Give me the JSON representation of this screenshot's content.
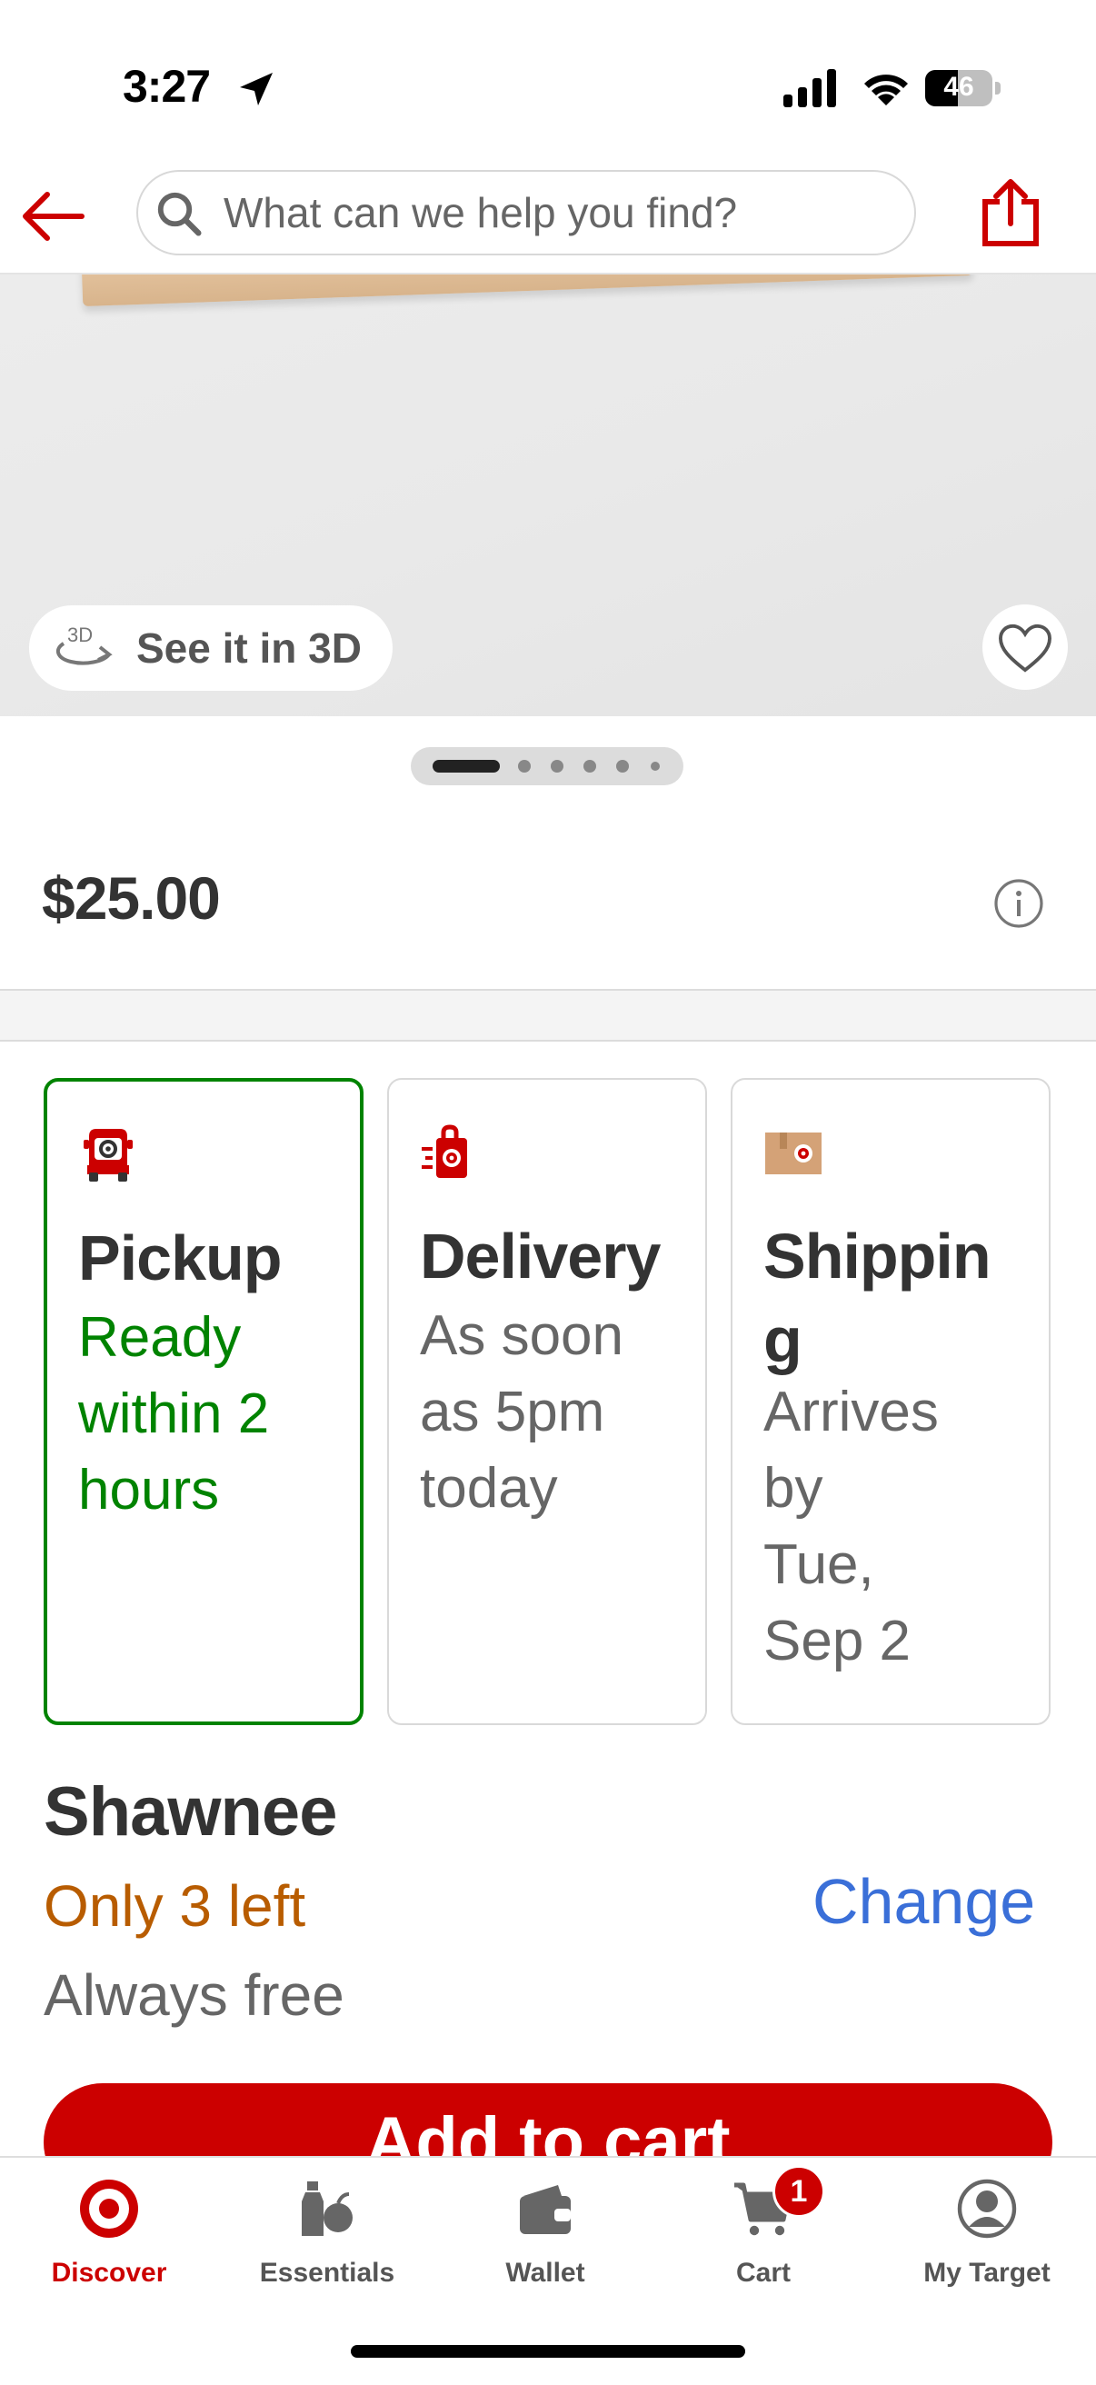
{
  "status_bar": {
    "time": "3:27",
    "battery": "46"
  },
  "header": {
    "search_placeholder": "What can we help you find?"
  },
  "hero": {
    "see_3d_label": "See it in 3D",
    "image_count": 6,
    "active_index": 0
  },
  "product": {
    "price": "$25.00"
  },
  "fulfillment": [
    {
      "title": "Pickup",
      "title_lines": [
        "Pickup"
      ],
      "subtitle_lines": [
        "Ready",
        "within 2",
        "hours"
      ],
      "selected": true,
      "icon": "pickup-car-icon"
    },
    {
      "title": "Delivery",
      "title_lines": [
        "Delivery"
      ],
      "subtitle_lines": [
        "As soon",
        "as 5pm",
        "today"
      ],
      "selected": false,
      "icon": "delivery-bag-icon"
    },
    {
      "title": "Shipping",
      "title_lines": [
        "Shippin",
        "g"
      ],
      "subtitle_lines": [
        "Arrives",
        "by",
        "Tue,",
        "Sep 2"
      ],
      "selected": false,
      "icon": "shipping-box-icon"
    }
  ],
  "store": {
    "name": "Shawnee",
    "stock": "Only 3 left",
    "price_note": "Always free",
    "change_label": "Change"
  },
  "add_to_cart": {
    "label": "Add to cart"
  },
  "tabbar": {
    "tabs": [
      {
        "label": "Discover",
        "icon": "target-bullseye-icon",
        "active": true
      },
      {
        "label": "Essentials",
        "icon": "essentials-icon",
        "active": false
      },
      {
        "label": "Wallet",
        "icon": "wallet-icon",
        "active": false
      },
      {
        "label": "Cart",
        "icon": "cart-icon",
        "active": false,
        "badge": "1"
      },
      {
        "label": "My Target",
        "icon": "profile-icon",
        "active": false
      }
    ]
  },
  "colors": {
    "brand_red": "#cc0000",
    "pickup_green": "#008300",
    "stock_orange": "#b85c00",
    "link_blue": "#3a6fd8"
  }
}
